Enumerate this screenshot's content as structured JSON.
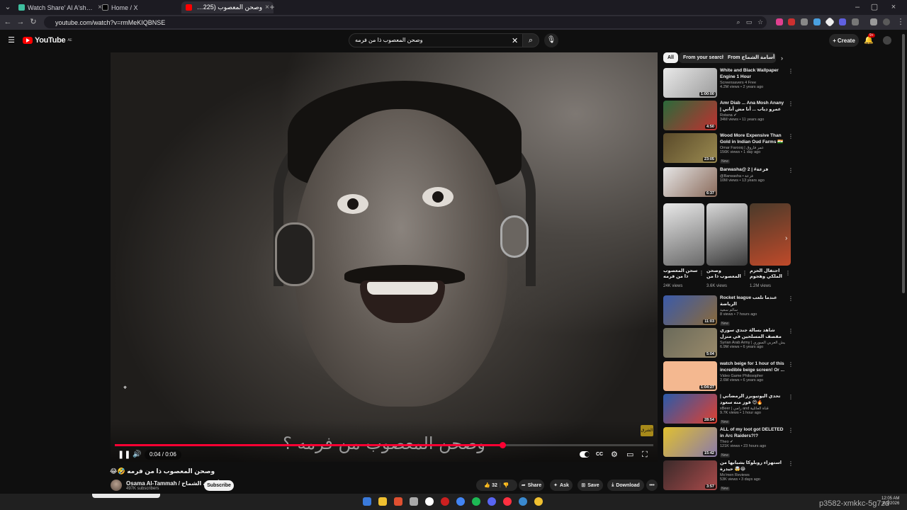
{
  "browser": {
    "tabs": [
      {
        "title": "Watch Share' Al A'sha - Season",
        "favicon_color": "#3fbf9f"
      },
      {
        "title": "Home / X",
        "favicon_color": "#000000"
      },
      {
        "title": "وصحن المعصوب (1225) ذا",
        "favicon_color": "#ff0000"
      }
    ],
    "new_tab": "+",
    "url": "youtube.com/watch?v=rmMeKIQBNSE"
  },
  "youtube": {
    "logo_text": "YouTube",
    "logo_region": "AE",
    "search_value": "وصحن المعصوب ذا من فرمه",
    "create_label": "Create",
    "notifications_badge": "9+"
  },
  "player": {
    "subtitle": "وصحن المعصوب من فرمه ؟",
    "watermark": "الشرق",
    "time": "0:04 / 0:06",
    "progress_fraction": 0.72,
    "controls": {
      "play_pause": "❚❚",
      "volume": "🔊",
      "captions": "CC",
      "settings": "⚙",
      "miniplayer": "▭",
      "fullscreen": "⛶"
    }
  },
  "video": {
    "title": "وصحن المعصوب ذا من فرمه 🤣😂",
    "channel": "Osama Al-Tammah / أسامة الشماح",
    "subscribers": "497K subscribers",
    "subscribe_label": "Subscribe",
    "like_count": "32",
    "share_label": "Share",
    "ask_label": "Ask",
    "save_label": "Save",
    "download_label": "Download",
    "more": "•••"
  },
  "sidebar": {
    "chips": [
      "All",
      "From your search",
      "From أسامة الشماح / Osam"
    ],
    "recs": [
      {
        "title": "White and Black Wallpaper Engine 1 Hour",
        "channel": "Screensavers 4 Free",
        "meta": "4.2M views • 2 years ago",
        "duration": "1:00:00",
        "new": "",
        "colors": [
          "#e9e9e9",
          "#9a9a9a"
        ]
      },
      {
        "title": "Amr Diab ... Ana Mosh Anany | عمرو دياب ... أنا مش أناني",
        "channel": "Rotana ✔",
        "meta": "34M views • 11 years ago",
        "duration": "4:50",
        "new": "",
        "colors": [
          "#2a6a3a",
          "#c03030"
        ]
      },
      {
        "title": "Wood More Expensive Than Gold in Indian Oud Farms 🇮🇳 ...",
        "channel": "Omar Farooq | عمر فاروق",
        "meta": "156K views • 1 day ago",
        "duration": "23:05",
        "new": "New",
        "colors": [
          "#5a4a2a",
          "#9a8a50"
        ]
      },
      {
        "title": "Barwasha@ 2 | #فزعة",
        "channel": "@Barwasha • فزعة",
        "meta": "10M views • 13 years ago",
        "duration": "6:37",
        "new": "",
        "colors": [
          "#e6e6e6",
          "#8a6a5a"
        ]
      },
      {
        "title": "Rocket league عندما تلعب الرياضة",
        "channel": "سالم سعيد",
        "meta": "8 views • 7 hours ago",
        "duration": "11:03",
        "new": "New",
        "colors": [
          "#3a5aaa",
          "#8a6a3a"
        ]
      },
      {
        "title": "شاهد بسالة جندي سوري مقصف المسلحين في منزل مدمر وتدمير هم على الفراغ",
        "channel": "Syrian Arab Army | الجيش العربي السوري",
        "meta": "6.9M views • 6 years ago",
        "duration": "5:04",
        "new": "",
        "colors": [
          "#6a6a5a",
          "#9a8a6a"
        ]
      },
      {
        "title": "watch beige for 1 hour of this incredible beige screen! Or ...",
        "channel": "Video Game Philosopher",
        "meta": "2.6M views • 6 years ago",
        "duration": "1:04:27",
        "new": "",
        "colors": [
          "#f4b890",
          "#f4b890"
        ]
      },
      {
        "title": "تحدي اليوتيوبرز الرمضاني | فوز منه سعود 😍🔥",
        "channel": "xBeer | رامي and قناة العائلية",
        "meta": "9.7K views • 1 hour ago",
        "duration": "28:54",
        "new": "New",
        "colors": [
          "#2a5aaa",
          "#e04030"
        ]
      },
      {
        "title": "ALL of my loot got DELETED in Arc Raiders?!?",
        "channel": "Theo ✔",
        "meta": "121K views • 23 hours ago",
        "duration": "15:42",
        "new": "New",
        "colors": [
          "#e0c030",
          "#8a7aaa"
        ]
      },
      {
        "title": "استهزاء روبلوكا بشبابها من حيدرة 🤯😂",
        "channel": "Mo'men Reviews",
        "meta": "53K views • 3 days ago",
        "duration": "3:57",
        "new": "New",
        "colors": [
          "#3a2a2a",
          "#aa4a4a"
        ]
      }
    ],
    "shorts": [
      {
        "title": "سحن المعصوب ذا من فرمه",
        "views": "24K views",
        "colors": [
          "#e8e8e8",
          "#6a6a6a"
        ]
      },
      {
        "title": "وصحن المعصوب ذا من فرمه؟",
        "views": "3.6K views",
        "colors": [
          "#d8d8d8",
          "#3a3a3a"
        ]
      },
      {
        "title": "احتفال الحزم الملكي وهجوم",
        "views": "1.2M views",
        "colors": [
          "#4a3a2a",
          "#c04a2a"
        ]
      }
    ]
  },
  "taskbar": {
    "icons": [
      "#3a7adb",
      "#f0c030",
      "#e05030",
      "#aaaaaa",
      "#ffffff",
      "#cc2020",
      "#4285f4",
      "#1db954",
      "#5865f2",
      "#ff3040",
      "#3a8ad0",
      "#f0c030"
    ],
    "time": "12:05 AM",
    "date": "2/2/2026"
  },
  "watermark_text": "p3582-xmkkc-5g7zd"
}
